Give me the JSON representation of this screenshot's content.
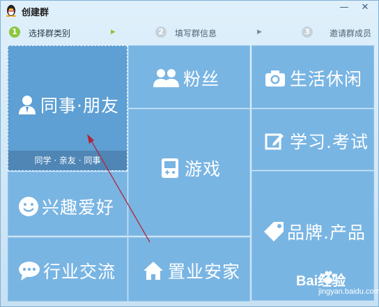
{
  "window": {
    "title": "创建群",
    "minimize_glyph": "—",
    "close_glyph": "✕"
  },
  "steps": [
    {
      "number": "1",
      "label": "选择群类别",
      "state": "active"
    },
    {
      "number": "2",
      "label": "填写群信息",
      "state": "inactive"
    },
    {
      "number": "3",
      "label": "邀请群成员",
      "state": "inactive"
    }
  ],
  "categories": [
    {
      "label": "同事·朋友",
      "subtitle": "同学 · 亲友 · 同事",
      "icon": "person-icon",
      "selected": true
    },
    {
      "label": "粉丝",
      "icon": "group-icon"
    },
    {
      "label": "生活休闲",
      "icon": "camera-icon"
    },
    {
      "label": "游戏",
      "icon": "gamepad-icon"
    },
    {
      "label": "学习.考试",
      "icon": "edit-icon"
    },
    {
      "label": "兴趣爱好",
      "icon": "smiley-icon"
    },
    {
      "label": "品牌.产品",
      "icon": "tag-icon"
    },
    {
      "label": "行业交流",
      "icon": "chat-icon"
    },
    {
      "label": "置业安家",
      "icon": "house-icon"
    }
  ],
  "watermark": {
    "brand": "Bai经验",
    "site": "jingyan.baidu.com"
  },
  "colors": {
    "tile": "#79b5e3",
    "tile_selected": "#5e9fd4",
    "step_active": "#8cc63f",
    "annotation_arrow": "#b0263c"
  }
}
